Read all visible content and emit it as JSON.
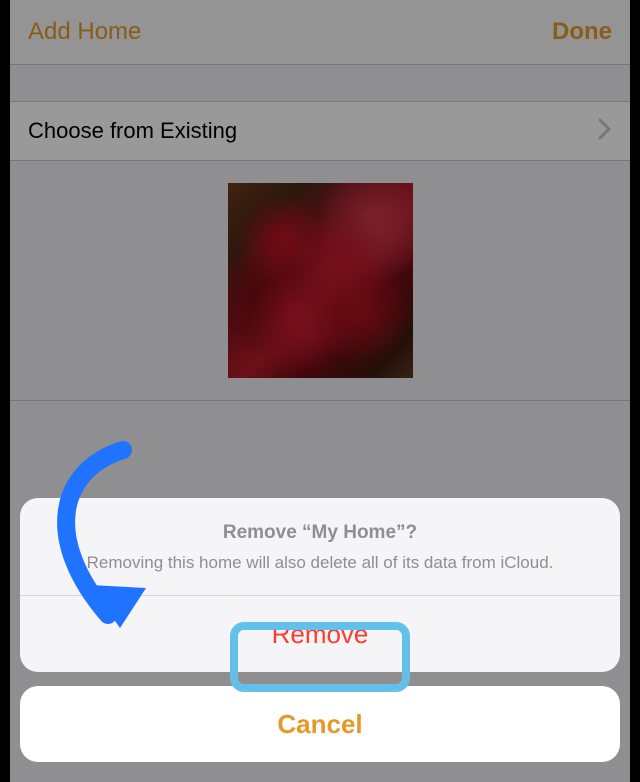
{
  "nav": {
    "title": "Add Home",
    "done": "Done"
  },
  "row": {
    "choose_existing": "Choose from Existing"
  },
  "sheet": {
    "title": "Remove “My Home”?",
    "message": "Removing this home will also delete all of its data from iCloud.",
    "remove": "Remove",
    "cancel": "Cancel"
  },
  "colors": {
    "accent": "#e49a2b",
    "destructive": "#ff3b30",
    "highlight": "#63c0ea",
    "arrow": "#1f73ff"
  }
}
